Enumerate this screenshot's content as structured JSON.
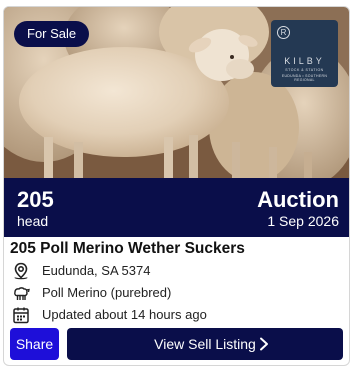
{
  "listing": {
    "badge": "For Sale",
    "logo": {
      "brand": "KILBY",
      "sub1": "STOCK & STATION",
      "sub2": "EUDUNDA • SOUTHERN REGIONAL"
    },
    "head_count": "205",
    "head_unit": "head",
    "sale_type": "Auction",
    "sale_date": "1 Sep 2026",
    "title": "205 Poll Merino Wether Suckers",
    "location": "Eudunda, SA 5374",
    "breed": "Poll Merino (purebred)",
    "updated": "Updated about 14 hours ago"
  },
  "actions": {
    "share_label": "Share",
    "view_label": "View Sell Listing"
  },
  "icons": {
    "location": "map-pin-icon",
    "breed": "sheep-icon",
    "updated": "calendar-icon",
    "view_arrow": "chevron-right-icon"
  },
  "colors": {
    "navy": "#0a0e4a",
    "share_blue": "#1e0fd9",
    "logo_bg": "#243953"
  }
}
